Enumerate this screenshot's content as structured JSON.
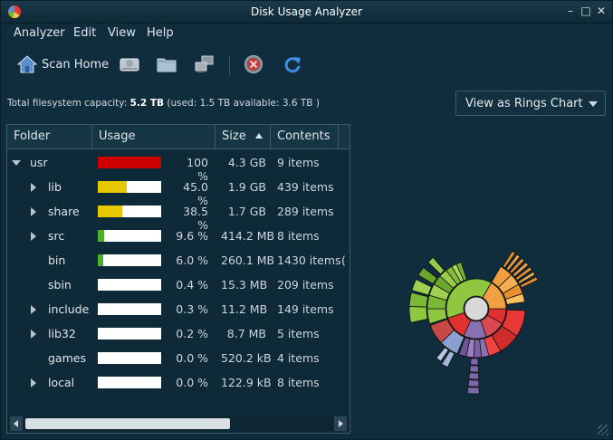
{
  "window": {
    "title": "Disk Usage Analyzer",
    "buttons": {
      "minimize": "–",
      "maximize": "□",
      "close": "✕"
    }
  },
  "menu": [
    {
      "label": "Analyzer"
    },
    {
      "label": "Edit"
    },
    {
      "label": "View"
    },
    {
      "label": "Help"
    }
  ],
  "toolbar": {
    "scan_home_label": "Scan Home",
    "icons": [
      "home-icon",
      "scan-filesystem-icon",
      "scan-folder-icon",
      "scan-remote-icon",
      "stop-icon",
      "refresh-icon"
    ]
  },
  "capacity": {
    "prefix": "Total filesystem capacity: ",
    "total": "5.2 TB",
    "detail": " (used: 1.5 TB available: 3.6 TB )"
  },
  "view_select": {
    "value": "View as Rings Chart"
  },
  "table": {
    "columns": {
      "folder": "Folder",
      "usage": "Usage",
      "size": "Size",
      "contents": "Contents"
    },
    "rows": [
      {
        "name": "usr",
        "expander": "expanded",
        "pct_value": 100,
        "pct": "100 %",
        "size": "4.3 GB",
        "contents": "9 items",
        "color": "#cc0000",
        "indent": 0
      },
      {
        "name": "lib",
        "expander": "collapsed",
        "pct_value": 45.0,
        "pct": "45.0 %",
        "size": "1.9 GB",
        "contents": "439 items",
        "color": "#e5c800",
        "indent": 1
      },
      {
        "name": "share",
        "expander": "collapsed",
        "pct_value": 38.5,
        "pct": "38.5 %",
        "size": "1.7 GB",
        "contents": "289 items",
        "color": "#e5c800",
        "indent": 1
      },
      {
        "name": "src",
        "expander": "collapsed",
        "pct_value": 9.6,
        "pct": "9.6 %",
        "size": "414.2 MB",
        "contents": "8 items",
        "color": "#4caf2c",
        "indent": 1
      },
      {
        "name": "bin",
        "expander": "none",
        "pct_value": 6.0,
        "pct": "6.0 %",
        "size": "260.1 MB",
        "contents": "1430 items",
        "extra": "(",
        "color": "#4caf2c",
        "indent": 1
      },
      {
        "name": "sbin",
        "expander": "none",
        "pct_value": 0.4,
        "pct": "0.4 %",
        "size": "15.3 MB",
        "contents": "209 items",
        "color": "#4caf2c",
        "indent": 1
      },
      {
        "name": "include",
        "expander": "collapsed",
        "pct_value": 0.3,
        "pct": "0.3 %",
        "size": "11.2 MB",
        "contents": "149 items",
        "color": "#4caf2c",
        "indent": 1
      },
      {
        "name": "lib32",
        "expander": "collapsed",
        "pct_value": 0.2,
        "pct": "0.2 %",
        "size": "8.7 MB",
        "contents": "5 items",
        "color": "#4caf2c",
        "indent": 1
      },
      {
        "name": "games",
        "expander": "none",
        "pct_value": 0.0,
        "pct": "0.0 %",
        "size": "520.2 kB",
        "contents": "4 items",
        "color": "#4caf2c",
        "indent": 1
      },
      {
        "name": "local",
        "expander": "collapsed",
        "pct_value": 0.0,
        "pct": "0.0 %",
        "size": "122.9 kB",
        "contents": "8 items",
        "color": "#4caf2c",
        "indent": 1
      }
    ],
    "hscroll_position": 0.0
  },
  "rings_chart": {
    "colors": {
      "red": "#e03030",
      "green": "#8fc840",
      "orange": "#f0a040",
      "purple": "#8a70b0",
      "blue": "#8aa0d0",
      "center": "#d8d8d8"
    }
  }
}
